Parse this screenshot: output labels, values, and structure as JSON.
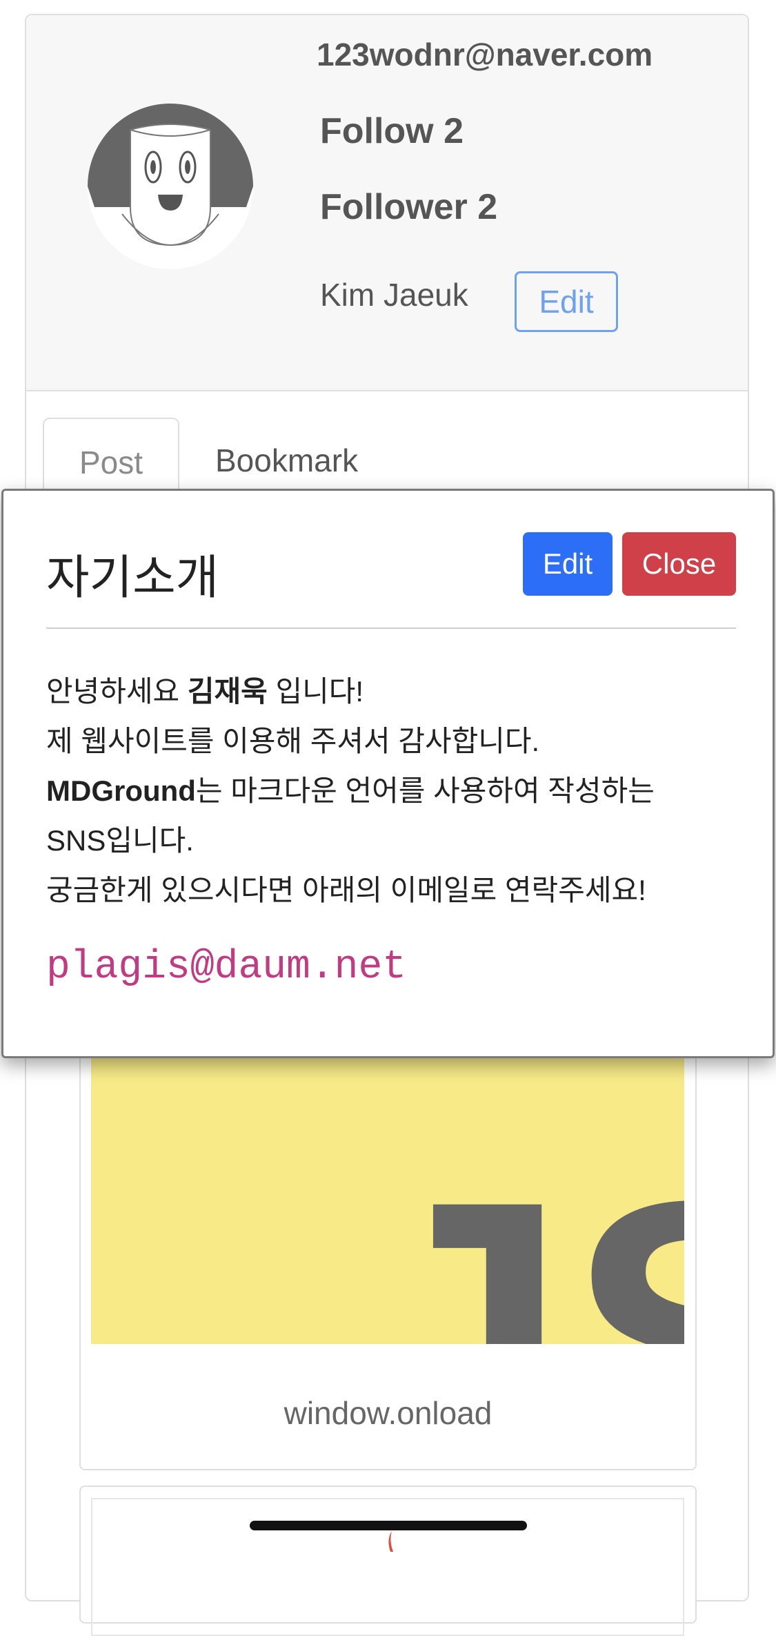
{
  "profile": {
    "email": "123wodnr@naver.com",
    "follow_label": "Follow 2",
    "follower_label": "Follower 2",
    "name": "Kim Jaeuk",
    "edit_label": "Edit"
  },
  "tabs": [
    {
      "label": "Post",
      "active": true
    },
    {
      "label": "Bookmark",
      "active": false
    }
  ],
  "posts": [
    {
      "title": "window.onload",
      "thumbnail_text": "JS",
      "thumbnail_bg": "#f7ea87"
    }
  ],
  "modal": {
    "title": "자기소개",
    "edit_label": "Edit",
    "close_label": "Close",
    "greeting_prefix": "안녕하세요 ",
    "greeting_name": "김재욱",
    "greeting_suffix": " 입니다!",
    "line2": "제 웹사이트를 이용해 주셔서 감사합니다.",
    "line3_bold": "MDGround",
    "line3_rest": "는 마크다운 언어를 사용하여 작성하는",
    "line4": "SNS입니다.",
    "line5": "궁금한게 있으시다면 아래의 이메일로 연락주세요!",
    "contact_email": "plagis@daum.net"
  },
  "colors": {
    "primary": "#2d6ef7",
    "danger": "#cf4049",
    "outline_primary": "#6ea2f0",
    "code_pink": "#c23b82"
  }
}
